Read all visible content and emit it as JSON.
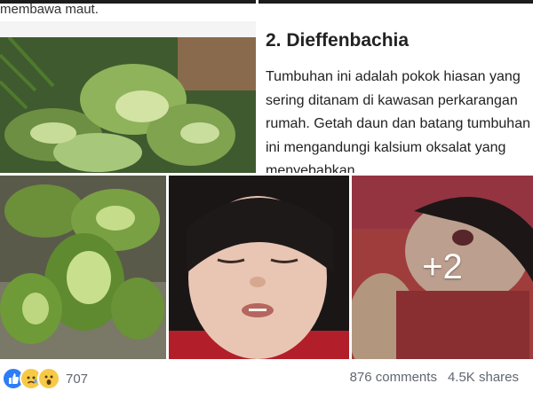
{
  "post": {
    "caption_fragment": "membawa maut.",
    "article": {
      "heading": "2. Dieffenbachia",
      "body": "Tumbuhan ini adalah pokok hiasan yang sering ditanam di kawasan perkarangan rumah. Getah daun dan batang tumbuhan ini mengandungi kalsium oksalat yang menyebabkan"
    },
    "more_photos": "+2"
  },
  "footer": {
    "reactions": [
      "like-icon",
      "sad-icon",
      "wow-icon"
    ],
    "reaction_count": "707",
    "comments": "876 comments",
    "shares": "4.5K shares"
  },
  "colors": {
    "like": "#2d7df6",
    "reaction_yellow": "#f7c948",
    "meta_text": "#616770"
  }
}
